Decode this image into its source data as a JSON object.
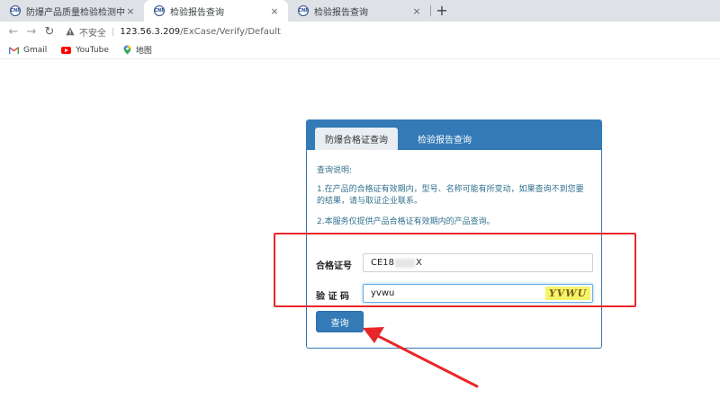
{
  "browser": {
    "tabs": [
      {
        "title": "防爆产品质量检验检测中心(天津",
        "active": false
      },
      {
        "title": "检验报告查询",
        "active": true
      },
      {
        "title": "检验报告查询",
        "active": false
      }
    ],
    "favicon_text": "CNE",
    "close_glyph": "×",
    "new_tab_glyph": "+",
    "security_label": "不安全",
    "url_host": "123.56.3.209",
    "url_path": "/ExCase/Verify/Default",
    "bookmarks": [
      {
        "label": "Gmail",
        "icon": "gmail-icon"
      },
      {
        "label": "YouTube",
        "icon": "youtube-icon"
      },
      {
        "label": "地图",
        "icon": "maps-icon"
      }
    ]
  },
  "panel": {
    "tabs": [
      {
        "label": "防爆合格证查询",
        "active": true
      },
      {
        "label": "检验报告查询",
        "active": false
      }
    ],
    "notes_heading": "查询说明:",
    "notes": [
      "1.在产品的合格证有效期内，型号、名称可能有所变动，如果查询不到您要的结果，请与取证企业联系。",
      "2.本服务仅提供产品合格证有效期内的产品查询。"
    ],
    "cert_label": "合格证号",
    "cert_value_prefix": "CE18",
    "cert_value_suffix": "X",
    "captcha_label": "验 证 码",
    "captcha_value": "yvwu",
    "captcha_image_text": "YVWU",
    "submit_label": "查询"
  },
  "colors": {
    "accent": "#337ab7",
    "note_text": "#31708f",
    "annotation": "#e8262a",
    "captcha_bg": "#f5f56a"
  }
}
